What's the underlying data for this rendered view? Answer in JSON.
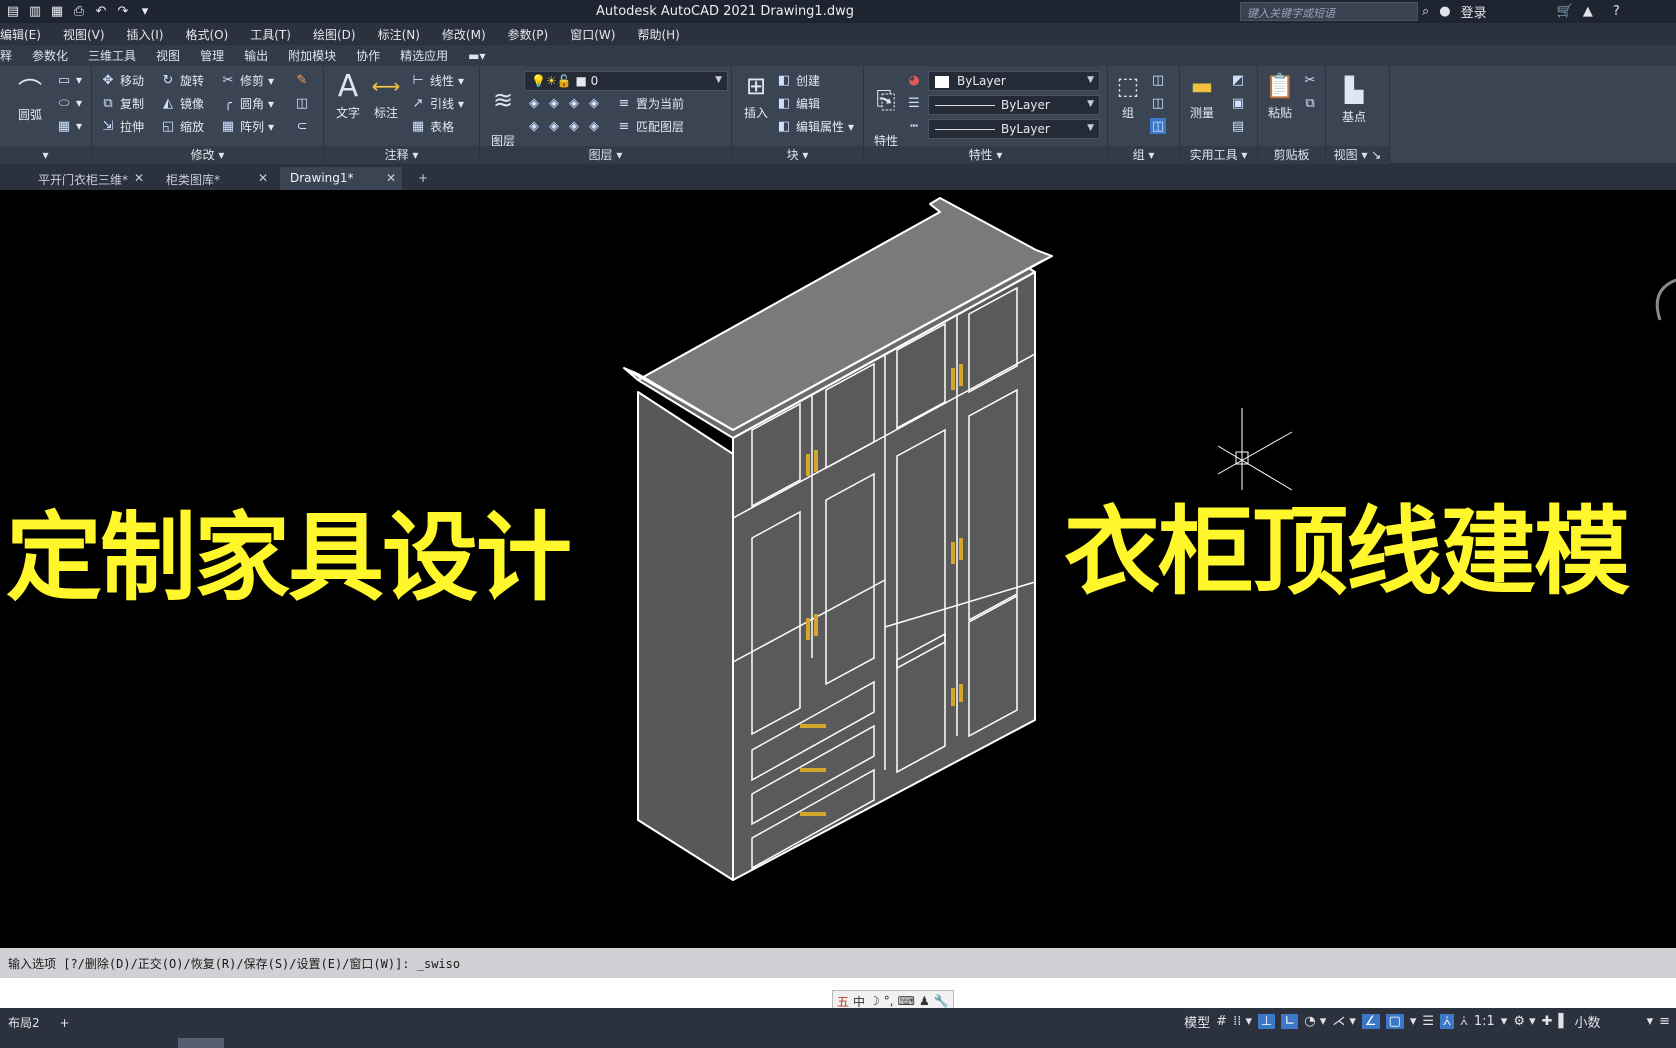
{
  "window": {
    "title": "Autodesk AutoCAD 2021    Drawing1.dwg",
    "search_placeholder": "键入关键字或短语",
    "login": "登录"
  },
  "menubar": [
    "编辑(E)",
    "视图(V)",
    "插入(I)",
    "格式(O)",
    "工具(T)",
    "绘图(D)",
    "标注(N)",
    "修改(M)",
    "参数(P)",
    "窗口(W)",
    "帮助(H)"
  ],
  "ribbon_tabs": [
    "释",
    "参数化",
    "三维工具",
    "视图",
    "管理",
    "输出",
    "附加模块",
    "协作",
    "精选应用"
  ],
  "ribbon": {
    "draw": {
      "arc": "圆弧"
    },
    "modify": {
      "title": "修改",
      "move": "移动",
      "rotate": "旋转",
      "trim": "修剪",
      "copy": "复制",
      "mirror": "镜像",
      "fillet": "圆角",
      "stretch": "拉伸",
      "scale": "缩放",
      "array": "阵列"
    },
    "annotation": {
      "title": "注释",
      "text": "文字",
      "dimension": "标注",
      "linear": "线性",
      "leader": "引线",
      "table": "表格"
    },
    "layers": {
      "title": "图层",
      "layer_props": "图层\n特性",
      "current_layer": "0",
      "set_current": "置为当前",
      "match_layer": "匹配图层"
    },
    "block": {
      "title": "块",
      "insert": "插入",
      "create": "创建",
      "edit": "编辑",
      "edit_attr": "编辑属性"
    },
    "properties": {
      "title": "特性",
      "match": "特性\n匹配",
      "color": "ByLayer",
      "linetype": "ByLayer",
      "lineweight": "ByLayer"
    },
    "groups": {
      "title": "组",
      "group": "组"
    },
    "utilities": {
      "title": "实用工具",
      "measure": "测量"
    },
    "clipboard": {
      "title": "剪贴板",
      "paste": "粘贴"
    },
    "view": {
      "title": "视图",
      "base": "基点"
    }
  },
  "file_tabs": [
    {
      "label": "平开门衣柜三维*"
    },
    {
      "label": "柜类图库*"
    },
    {
      "label": "Drawing1*"
    }
  ],
  "overlay": {
    "left": "定制家具设计",
    "right": "衣柜顶线建模"
  },
  "command_line": "输入选项 [?/删除(D)/正交(O)/恢复(R)/保存(S)/设置(E)/窗口(W)]: _swiso",
  "ime": [
    "五",
    "中",
    "☽",
    "°,",
    "⌨",
    "♟",
    "🔧"
  ],
  "status": {
    "layout": "布局2",
    "model": "模型",
    "scale": "1:1",
    "units": "小数"
  },
  "colors": {
    "overlay_text": "#fff72b",
    "canvas": "#000000",
    "ribbon": "#3b4453"
  }
}
